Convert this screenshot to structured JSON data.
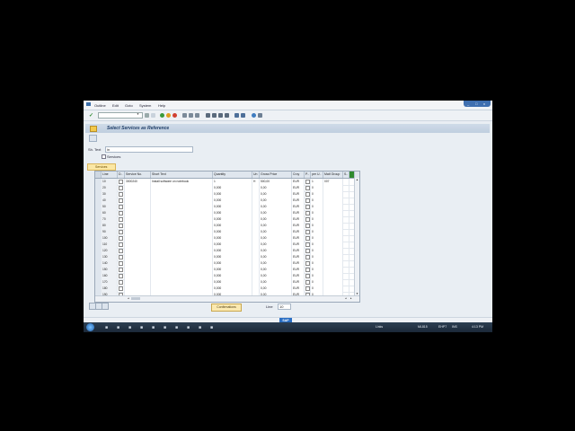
{
  "menu": [
    "Outline",
    "Edit",
    "Goto",
    "System",
    "Help"
  ],
  "window_controls": [
    "_",
    "□",
    "x"
  ],
  "toolbar": {
    "check_icon": "check-icon"
  },
  "screen_title": "Select Services as Reference",
  "sh_text_label": "Sh. Text",
  "sh_text_value": "in",
  "services_checkbox_label": "Services",
  "tab_label": "Services",
  "table": {
    "columns": [
      "Line",
      "D..",
      "Service No.",
      "Short Text",
      "Quantity",
      "Un",
      "Gross Price",
      "Crcy",
      "P..",
      "per U..",
      "Matl Group",
      "S.."
    ],
    "rows": [
      {
        "line": "10",
        "service": "3000240",
        "text": "Install software on notebook",
        "qty": "1",
        "un": "H",
        "price": "500,00",
        "crcy": "EUR",
        "per": "1",
        "matl": "007"
      },
      {
        "line": "20",
        "service": "",
        "text": "",
        "qty": "0,000",
        "un": "",
        "price": "0,00",
        "crcy": "EUR",
        "per": "0",
        "matl": ""
      },
      {
        "line": "30",
        "service": "",
        "text": "",
        "qty": "0,000",
        "un": "",
        "price": "0,00",
        "crcy": "EUR",
        "per": "0",
        "matl": ""
      },
      {
        "line": "40",
        "service": "",
        "text": "",
        "qty": "0,000",
        "un": "",
        "price": "0,00",
        "crcy": "EUR",
        "per": "0",
        "matl": ""
      },
      {
        "line": "50",
        "service": "",
        "text": "",
        "qty": "0,000",
        "un": "",
        "price": "0,00",
        "crcy": "EUR",
        "per": "0",
        "matl": ""
      },
      {
        "line": "60",
        "service": "",
        "text": "",
        "qty": "0,000",
        "un": "",
        "price": "0,00",
        "crcy": "EUR",
        "per": "0",
        "matl": ""
      },
      {
        "line": "70",
        "service": "",
        "text": "",
        "qty": "0,000",
        "un": "",
        "price": "0,00",
        "crcy": "EUR",
        "per": "0",
        "matl": ""
      },
      {
        "line": "80",
        "service": "",
        "text": "",
        "qty": "0,000",
        "un": "",
        "price": "0,00",
        "crcy": "EUR",
        "per": "0",
        "matl": ""
      },
      {
        "line": "90",
        "service": "",
        "text": "",
        "qty": "0,000",
        "un": "",
        "price": "0,00",
        "crcy": "EUR",
        "per": "0",
        "matl": ""
      },
      {
        "line": "100",
        "service": "",
        "text": "",
        "qty": "0,000",
        "un": "",
        "price": "0,00",
        "crcy": "EUR",
        "per": "0",
        "matl": ""
      },
      {
        "line": "110",
        "service": "",
        "text": "",
        "qty": "0,000",
        "un": "",
        "price": "0,00",
        "crcy": "EUR",
        "per": "0",
        "matl": ""
      },
      {
        "line": "120",
        "service": "",
        "text": "",
        "qty": "0,000",
        "un": "",
        "price": "0,00",
        "crcy": "EUR",
        "per": "0",
        "matl": ""
      },
      {
        "line": "130",
        "service": "",
        "text": "",
        "qty": "0,000",
        "un": "",
        "price": "0,00",
        "crcy": "EUR",
        "per": "0",
        "matl": ""
      },
      {
        "line": "140",
        "service": "",
        "text": "",
        "qty": "0,000",
        "un": "",
        "price": "0,00",
        "crcy": "EUR",
        "per": "0",
        "matl": ""
      },
      {
        "line": "150",
        "service": "",
        "text": "",
        "qty": "0,000",
        "un": "",
        "price": "0,00",
        "crcy": "EUR",
        "per": "0",
        "matl": ""
      },
      {
        "line": "160",
        "service": "",
        "text": "",
        "qty": "0,000",
        "un": "",
        "price": "0,00",
        "crcy": "EUR",
        "per": "0",
        "matl": ""
      },
      {
        "line": "170",
        "service": "",
        "text": "",
        "qty": "0,000",
        "un": "",
        "price": "0,00",
        "crcy": "EUR",
        "per": "0",
        "matl": ""
      },
      {
        "line": "180",
        "service": "",
        "text": "",
        "qty": "0,000",
        "un": "",
        "price": "0,00",
        "crcy": "EUR",
        "per": "0",
        "matl": ""
      },
      {
        "line": "190",
        "service": "",
        "text": "",
        "qty": "0,000",
        "un": "",
        "price": "0,00",
        "crcy": "EUR",
        "per": "0",
        "matl": ""
      }
    ]
  },
  "confirmations_button": "Confirmations",
  "line_label": "Line",
  "line_value": "10",
  "status": {
    "sap_logo": "SAP"
  },
  "taskbar": {
    "tray_links": "Links",
    "system": "ML815",
    "server": "EHP7",
    "mode": "INS",
    "time": "4:13 PM"
  }
}
